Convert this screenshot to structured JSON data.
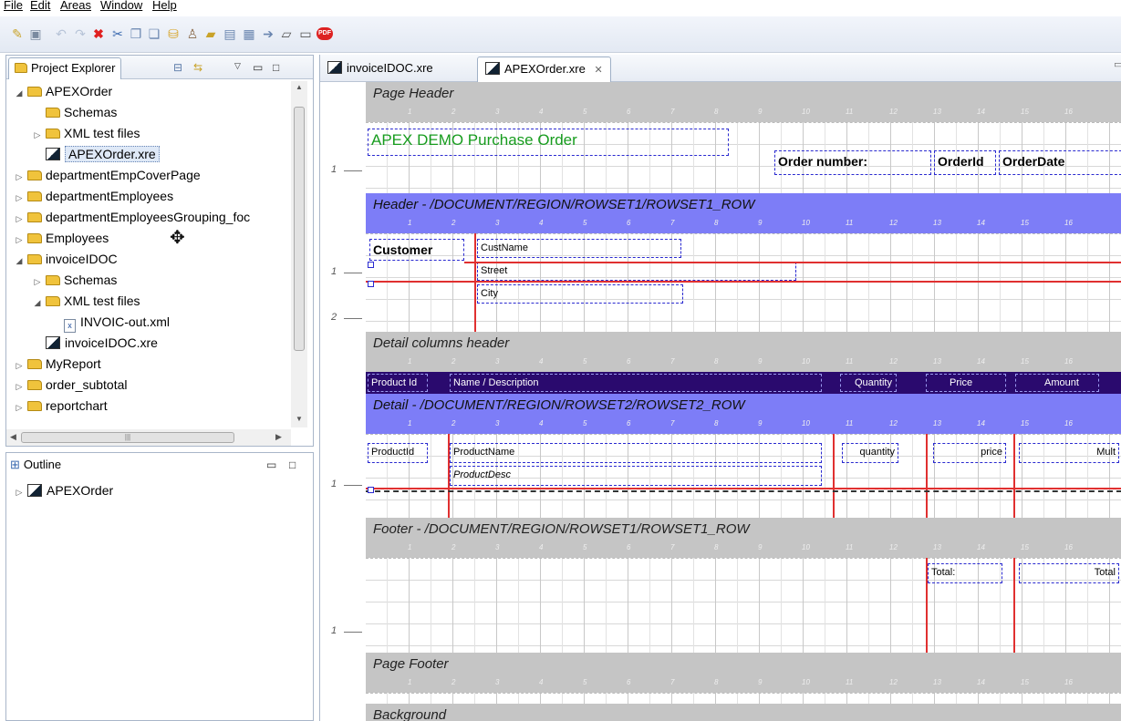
{
  "menu": [
    "File",
    "Edit",
    "Areas",
    "Window",
    "Help"
  ],
  "toolbar_icons": [
    "new-icon",
    "save-icon",
    "undo-icon",
    "redo-icon",
    "delete-icon",
    "cut-icon",
    "copy-icon",
    "paste-icon",
    "database-icon",
    "users-icon",
    "open-folder-icon",
    "open-folder-2-icon",
    "layout-icon",
    "export-icon",
    "open-report-icon",
    "open-folder-3-icon",
    "pdf-icon"
  ],
  "pdf_label": "PDF",
  "project_explorer": {
    "tab_label": "Project Explorer",
    "tree": [
      {
        "label": "APEXOrder",
        "type": "folder",
        "level": 0,
        "expanded": true
      },
      {
        "label": "Schemas",
        "type": "folder",
        "level": 1,
        "noarrow": true
      },
      {
        "label": "XML test files",
        "type": "folder",
        "level": 1,
        "expanded": false
      },
      {
        "label": "APEXOrder.xre",
        "type": "xre",
        "level": 1,
        "selected": true,
        "noarrow": true
      },
      {
        "label": "departmentEmpCoverPage",
        "type": "folder",
        "level": 0,
        "expanded": false
      },
      {
        "label": "departmentEmployees",
        "type": "folder",
        "level": 0,
        "expanded": false
      },
      {
        "label": "departmentEmployeesGrouping_foc",
        "type": "folder",
        "level": 0,
        "expanded": false
      },
      {
        "label": "Employees",
        "type": "folder",
        "level": 0,
        "expanded": false
      },
      {
        "label": "invoiceIDOC",
        "type": "folder",
        "level": 0,
        "expanded": true
      },
      {
        "label": "Schemas",
        "type": "folder",
        "level": 1,
        "expanded": false
      },
      {
        "label": "XML test files",
        "type": "folder",
        "level": 1,
        "expanded": true
      },
      {
        "label": "INVOIC-out.xml",
        "type": "xml",
        "level": 2,
        "noarrow": true
      },
      {
        "label": "invoiceIDOC.xre",
        "type": "xre",
        "level": 1,
        "noarrow": true
      },
      {
        "label": "MyReport",
        "type": "folder",
        "level": 0,
        "expanded": false
      },
      {
        "label": "order_subtotal",
        "type": "folder",
        "level": 0,
        "expanded": false
      },
      {
        "label": "reportchart",
        "type": "folder",
        "level": 0,
        "expanded": false
      }
    ]
  },
  "outline": {
    "tab_label": "Outline",
    "item": "APEXOrder"
  },
  "editor_tabs": [
    {
      "label": "invoiceIDOC.xre",
      "active": false
    },
    {
      "label": "APEXOrder.xre",
      "active": true
    }
  ],
  "ruler_numbers": [
    "1",
    "2",
    "3",
    "4",
    "5",
    "6",
    "7",
    "8",
    "9",
    "10",
    "11",
    "12",
    "13",
    "14",
    "15",
    "16"
  ],
  "bands": {
    "page_header": "Page Header",
    "header": "Header - /DOCUMENT/REGION/ROWSET1/ROWSET1_ROW",
    "detail_columns_header": "Detail columns header",
    "detail": "Detail - /DOCUMENT/REGION/ROWSET2/ROWSET2_ROW",
    "footer": "Footer - /DOCUMENT/REGION/ROWSET1/ROWSET1_ROW",
    "page_footer": "Page Footer",
    "background": "Background"
  },
  "fields": {
    "title": "APEX DEMO Purchase Order",
    "order_number_label": "Order number:",
    "order_id": "OrderId",
    "order_date": "OrderDate",
    "customer": "Customer",
    "cust_name": "CustName",
    "street": "Street",
    "city": "City",
    "col_product_id": "Product Id",
    "col_name": "Name / Description",
    "col_quantity": "Quantity",
    "col_price": "Price",
    "col_amount": "Amount",
    "product_id": "ProductId",
    "product_name": "ProductName",
    "product_desc": "ProductDesc",
    "quantity": "quantity",
    "price": "price",
    "mult": "Mult",
    "total_label": "Total:",
    "total": "Total"
  },
  "vruler": [
    "1",
    "1",
    "2",
    "1",
    "1"
  ]
}
